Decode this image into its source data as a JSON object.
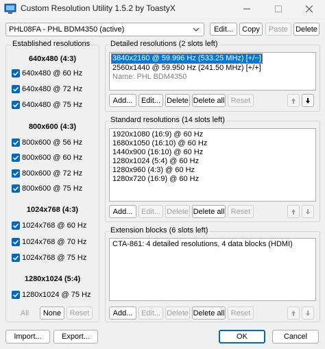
{
  "window": {
    "title": "Custom Resolution Utility 1.5.2 by ToastyX"
  },
  "monitor": {
    "selected": "PHL08FA - PHL BDM4350 (active)",
    "edit_label": "Edit...",
    "copy_label": "Copy",
    "paste_label": "Paste",
    "delete_label": "Delete"
  },
  "established": {
    "title": "Established resolutions",
    "groups": [
      {
        "header": "640x480 (4:3)",
        "items": [
          "640x480 @ 60 Hz",
          "640x480 @ 72 Hz",
          "640x480 @ 75 Hz"
        ]
      },
      {
        "header": "800x600 (4:3)",
        "items": [
          "800x600 @ 56 Hz",
          "800x600 @ 60 Hz",
          "800x600 @ 72 Hz",
          "800x600 @ 75 Hz"
        ]
      },
      {
        "header": "1024x768 (4:3)",
        "items": [
          "1024x768 @ 60 Hz",
          "1024x768 @ 70 Hz",
          "1024x768 @ 75 Hz"
        ]
      },
      {
        "header": "1280x1024 (5:4)",
        "items": [
          "1280x1024 @ 75 Hz"
        ]
      }
    ],
    "all_label": "All",
    "none_label": "None",
    "reset_label": "Reset"
  },
  "detailed": {
    "title": "Detailed resolutions (2 slots left)",
    "items": [
      "3840x2160 @ 59.996 Hz (533.25 MHz) [+/−]",
      "2560x1440 @ 59.950 Hz (241.50 MHz) [+/+]"
    ],
    "name_line": "Name: PHL BDM4350",
    "add_label": "Add...",
    "edit_label": "Edit...",
    "delete_label": "Delete",
    "delete_all_label": "Delete all",
    "reset_label": "Reset"
  },
  "standard": {
    "title": "Standard resolutions (14 slots left)",
    "items": [
      "1920x1080 (16:9) @ 60 Hz",
      "1680x1050 (16:10) @ 60 Hz",
      "1440x900 (16:10) @ 60 Hz",
      "1280x1024 (5:4) @ 60 Hz",
      "1280x960 (4:3) @ 60 Hz",
      "1280x720 (16:9) @ 60 Hz"
    ],
    "add_label": "Add...",
    "edit_label": "Edit...",
    "delete_label": "Delete",
    "delete_all_label": "Delete all",
    "reset_label": "Reset"
  },
  "extension": {
    "title": "Extension blocks (6 slots left)",
    "items": [
      "CTA-861: 4 detailed resolutions, 4 data blocks (HDMI)"
    ],
    "add_label": "Add...",
    "edit_label": "Edit...",
    "delete_label": "Delete",
    "delete_all_label": "Delete all",
    "reset_label": "Reset"
  },
  "footer": {
    "import_label": "Import...",
    "export_label": "Export...",
    "ok_label": "OK",
    "cancel_label": "Cancel"
  },
  "colors": {
    "accent": "#0067c0",
    "selection": "#0078d7",
    "window_bg": "#f0f0f0"
  }
}
